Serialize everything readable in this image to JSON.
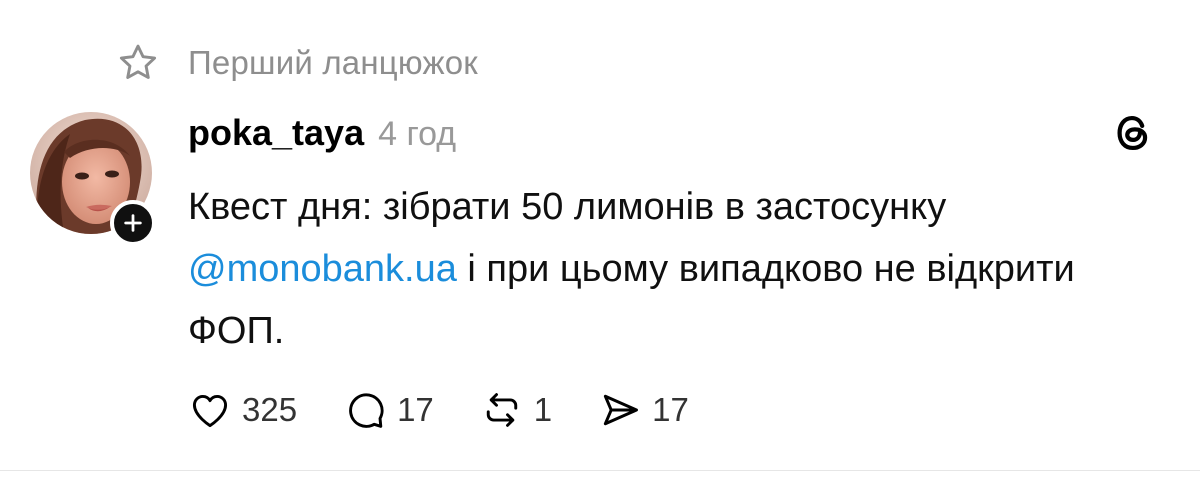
{
  "thread_label": "Перший ланцюжок",
  "post": {
    "username": "poka_taya",
    "time": "4 год",
    "text_before_mention": "Квест дня: зібрати 50 лимонів в застосунку",
    "mention": "@monobank.ua",
    "text_after_mention": " і при цьому випадково не відкрити ФОП."
  },
  "actions": {
    "likes": "325",
    "replies": "17",
    "reposts": "1",
    "shares": "17"
  },
  "icons": {
    "thread_label": "star-icon",
    "follow": "plus-icon",
    "app": "threads-logo-icon",
    "like": "heart-icon",
    "reply": "comment-icon",
    "repost": "repost-icon",
    "share": "send-icon"
  },
  "colors": {
    "mention": "#1b8ddb",
    "muted": "#999999",
    "badge": "#101010"
  }
}
